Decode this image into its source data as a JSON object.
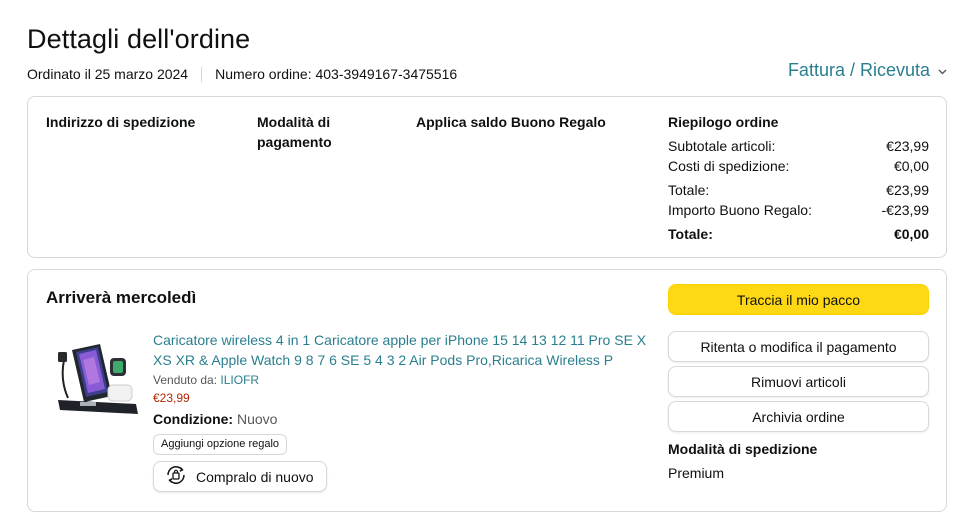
{
  "header": {
    "title": "Dettagli dell'ordine",
    "ordered_on": "Ordinato il 25 marzo 2024",
    "order_number": "Numero ordine: 403-3949167-3475516",
    "invoice_link": "Fattura / Ricevuta",
    "invoice_icon": "chevron-down-icon"
  },
  "details": {
    "shipping_address_label": "Indirizzo di spedizione",
    "payment_method_label": "Modalità di pagamento",
    "gift_card_label": "Applica saldo Buono Regalo",
    "summary": {
      "title": "Riepilogo ordine",
      "rows": [
        {
          "label": "Subtotale articoli:",
          "value": "€23,99"
        },
        {
          "label": "Costi di spedizione:",
          "value": "€0,00"
        },
        {
          "label": "Totale:",
          "value": "€23,99"
        },
        {
          "label": "Importo Buono Regalo:",
          "value": "-€23,99"
        },
        {
          "label": "Totale:",
          "value": "€0,00"
        }
      ]
    }
  },
  "shipment": {
    "arrival": "Arriverà mercoledì",
    "product": {
      "title": "Caricatore wireless 4 in 1 Caricatore apple per iPhone 15 14 13 12 11 Pro SE X XS XR & Apple Watch 9 8 7 6 SE 5 4 3 2 Air Pods Pro,Ricarica Wireless P",
      "sold_by_label": "Venduto da:",
      "seller": "ILIOFR",
      "price": "€23,99",
      "condition_label": "Condizione:",
      "condition_value": "Nuovo",
      "gift_option": "Aggiungi opzione regalo",
      "buy_again": "Compralo di nuovo"
    },
    "actions": {
      "track": "Traccia il mio pacco",
      "retry_payment": "Ritenta o modifica il pagamento",
      "remove_items": "Rimuovi articoli",
      "archive": "Archivia ordine"
    },
    "shipping_method_label": "Modalità di spedizione",
    "shipping_method_value": "Premium"
  },
  "colors": {
    "link": "#2a7f8f",
    "price": "#b12704",
    "primary_button": "#ffd814",
    "border": "#d5d9d9"
  }
}
